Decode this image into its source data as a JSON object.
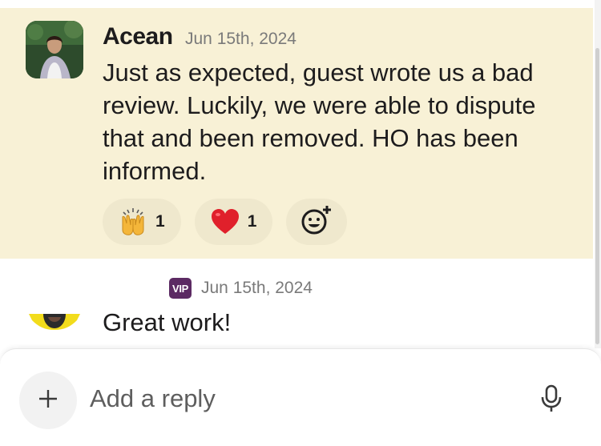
{
  "thread": {
    "message1": {
      "sender": "Acean",
      "timestamp": "Jun 15th, 2024",
      "text": "Just as expected, guest wrote us a bad review. Luckily, we were able to dispute that and been removed. HO has been informed.",
      "reactions": [
        {
          "icon": "raising-hands-emoji",
          "count": "1"
        },
        {
          "icon": "red-heart-emoji",
          "count": "1"
        }
      ],
      "add_reaction_icon": "add-emoji-icon"
    },
    "message2": {
      "badge": "VIP",
      "timestamp": "Jun 15th, 2024",
      "text": "Great work!"
    }
  },
  "composer": {
    "placeholder": "Add a reply",
    "plus_icon": "plus-icon",
    "mic_icon": "microphone-icon"
  },
  "colors": {
    "highlight_bg": "#f8f1d6",
    "reaction_bg": "#efe8cd",
    "vip_badge": "#5c2a63",
    "heart": "#e0202b"
  }
}
